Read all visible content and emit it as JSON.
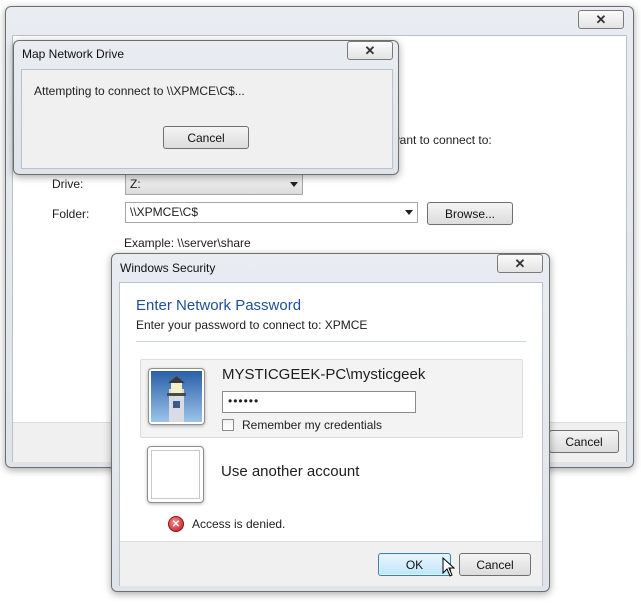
{
  "main_window": {
    "heading_partial": "want to connect to:",
    "drive_label": "Drive:",
    "drive_value": "Z:",
    "folder_label": "Folder:",
    "folder_value": "\\\\XPMCE\\C$",
    "browse_label": "Browse...",
    "example_text": "Example: \\\\server\\share",
    "cancel_label": "Cancel",
    "close_glyph": "✕"
  },
  "map_dialog": {
    "title": "Map Network Drive",
    "message": "Attempting to connect to \\\\XPMCE\\C$...",
    "cancel_label": "Cancel",
    "close_glyph": "✕"
  },
  "security_dialog": {
    "title": "Windows Security",
    "heading": "Enter Network Password",
    "subtext": "Enter your password to connect to: XPMCE",
    "account_name": "MYSTICGEEK-PC\\mysticgeek",
    "password_value": "••••••",
    "remember_label": "Remember my credentials",
    "other_account_label": "Use another account",
    "error_text": "Access is denied.",
    "ok_label": "OK",
    "cancel_label": "Cancel",
    "close_glyph": "✕",
    "heading_color": "#1f4e9c",
    "error_color": "#d2262b"
  }
}
